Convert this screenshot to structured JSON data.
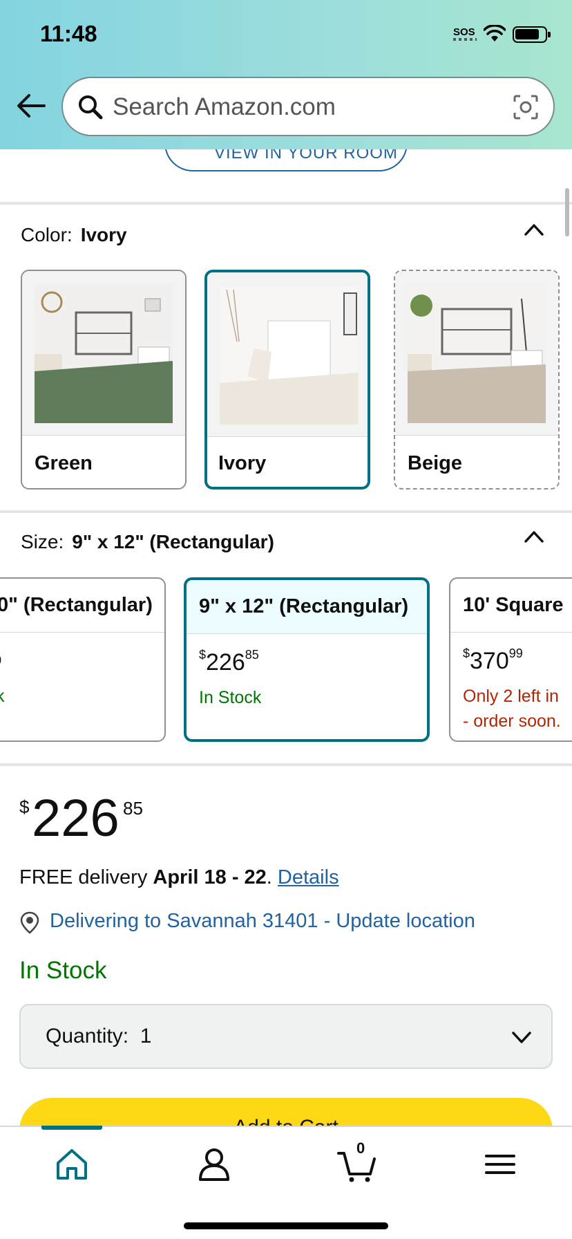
{
  "status_bar": {
    "time": "11:48",
    "sos": "SOS"
  },
  "search": {
    "placeholder": "Search Amazon.com"
  },
  "view_in_room": {
    "label": "VIEW IN YOUR ROOM"
  },
  "color": {
    "label": "Color:",
    "selected": "Ivory",
    "options": [
      {
        "name": "Green",
        "rug_color": "#5f7b5a"
      },
      {
        "name": "Ivory",
        "rug_color": "#ece6dc"
      },
      {
        "name": "Beige",
        "rug_color": "#c9bdaf"
      }
    ]
  },
  "size": {
    "label": "Size:",
    "selected": "9\" x 12\" (Rectangular)",
    "options": [
      {
        "title": "0\" (Rectangular)",
        "price_whole": "0",
        "price_frac": "",
        "stock": "k"
      },
      {
        "title": "9\" x 12\" (Rectangular)",
        "price_symbol": "$",
        "price_whole": "226",
        "price_frac": "85",
        "stock": "In Stock"
      },
      {
        "title": "10' Square",
        "price_symbol": "$",
        "price_whole": "370",
        "price_frac": "99",
        "stock_line1": "Only 2 left in",
        "stock_line2": "- order soon."
      }
    ]
  },
  "price": {
    "symbol": "$",
    "whole": "226",
    "fraction": "85"
  },
  "delivery": {
    "prefix": "FREE delivery ",
    "dates": "April 18 - 22",
    "suffix": ". ",
    "details_link": "Details"
  },
  "location": {
    "text": "Delivering to Savannah 31401 - Update location"
  },
  "availability": "In Stock",
  "quantity": {
    "label": "Quantity:",
    "value": "1"
  },
  "add_to_cart": {
    "label": "Add to Cart"
  },
  "nav": {
    "cart_count": "0"
  },
  "colors": {
    "accent": "#007185",
    "link": "#2162a1",
    "in_stock": "#007600",
    "low_stock": "#b12704",
    "cart_button": "#ffd814"
  }
}
